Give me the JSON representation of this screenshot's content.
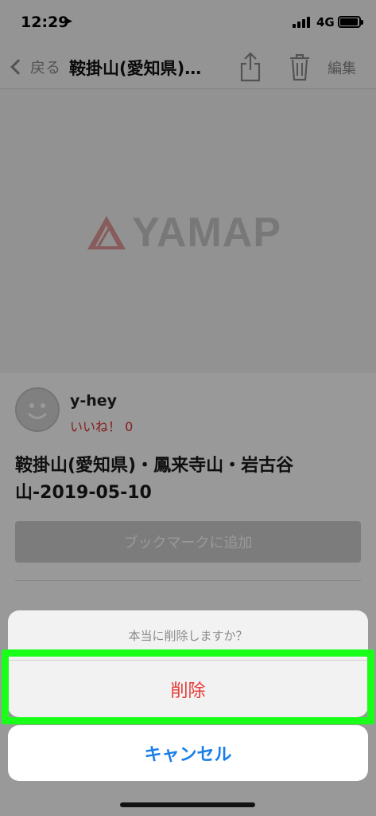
{
  "status_bar": {
    "time": "12:29",
    "network": "4G"
  },
  "nav": {
    "back_label": "戻る",
    "title": "鞍掛山(愛知県)…",
    "edit_label": "編集"
  },
  "hero": {
    "logo_text": "YAMAP"
  },
  "post": {
    "username": "y-hey",
    "likes_label": "いいね！ 0",
    "title": "鞍掛山(愛知県)・鳳来寺山・岩古谷山-2019-05-10",
    "bookmark_label": "ブックマークに追加"
  },
  "action_sheet": {
    "message": "本当に削除しますか？",
    "delete_label": "削除",
    "cancel_label": "キャンセル"
  },
  "colors": {
    "destructive": "#e53935",
    "accent_blue": "#1a7fe8",
    "highlight_green": "#1aff1a"
  }
}
